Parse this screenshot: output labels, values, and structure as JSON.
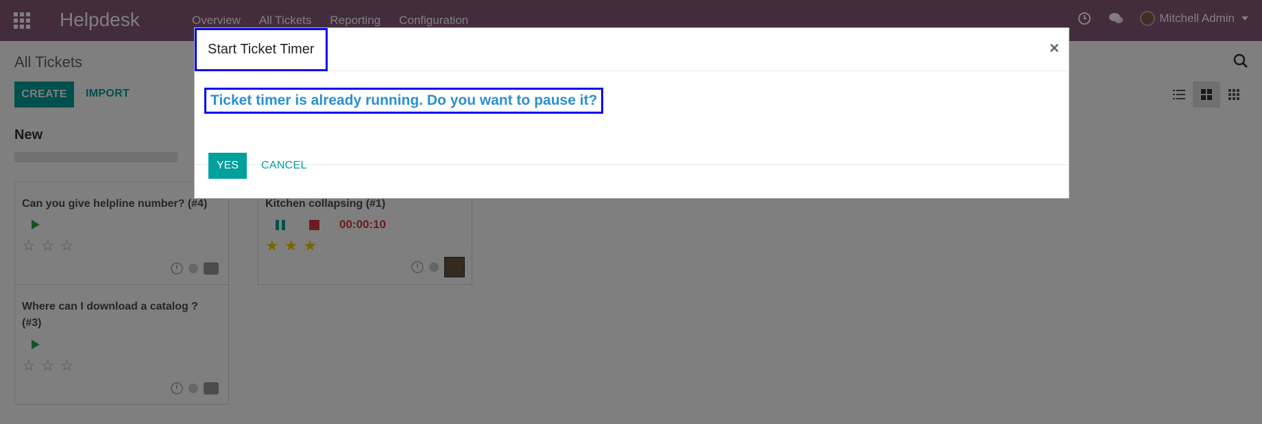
{
  "navbar": {
    "brand": "Helpdesk",
    "menu": [
      "Overview",
      "All Tickets",
      "Reporting",
      "Configuration"
    ],
    "user_name": "Mitchell Admin"
  },
  "control_panel": {
    "title": "All Tickets",
    "create_label": "CREATE",
    "import_label": "IMPORT"
  },
  "kanban": {
    "column_title": "New",
    "cards": [
      {
        "title": "Can you give helpline number? (#4)",
        "rating": 0
      },
      {
        "title": "Where can I download a catalog ? (#3)",
        "rating": 0
      },
      {
        "title": "Kitchen collapsing (#1)",
        "timer": "00:00:10",
        "rating": 3
      }
    ]
  },
  "dialog": {
    "title": "Start Ticket Timer",
    "message": "Ticket timer is already running. Do you want to pause it?",
    "yes_label": "YES",
    "cancel_label": "CANCEL",
    "close_symbol": "×"
  },
  "colors": {
    "navbar": "#875a7b",
    "primary": "#00a09d",
    "message": "#2b8fd0",
    "timer": "#dc3545"
  }
}
